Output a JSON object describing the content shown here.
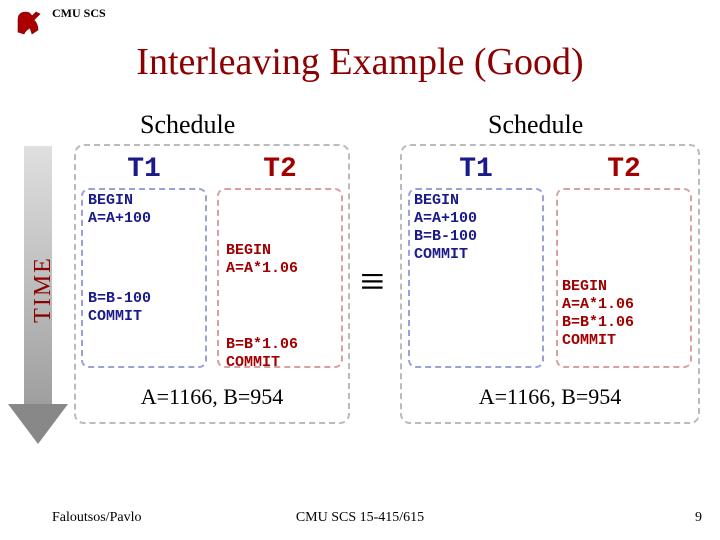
{
  "header": "CMU SCS",
  "title": "Interleaving Example (Good)",
  "time_label": "TIME",
  "equiv": "≡",
  "schedule_label": "Schedule",
  "t1_label": "T1",
  "t2_label": "T2",
  "left": {
    "t1": {
      "seg1": "BEGIN\nA=A+100",
      "seg2": "B=B-100\nCOMMIT"
    },
    "t2": {
      "seg1": "BEGIN\nA=A*1.06",
      "seg2": "B=B*1.06\nCOMMIT"
    },
    "result": "A=1166, B=954"
  },
  "right": {
    "t1": {
      "seg1": "BEGIN\nA=A+100\nB=B-100\nCOMMIT"
    },
    "t2": {
      "seg1": "BEGIN\nA=A*1.06\nB=B*1.06\nCOMMIT"
    },
    "result": "A=1166, B=954"
  },
  "footer": {
    "left": "Faloutsos/Pavlo",
    "mid": "CMU SCS 15-415/615",
    "page": "9"
  }
}
